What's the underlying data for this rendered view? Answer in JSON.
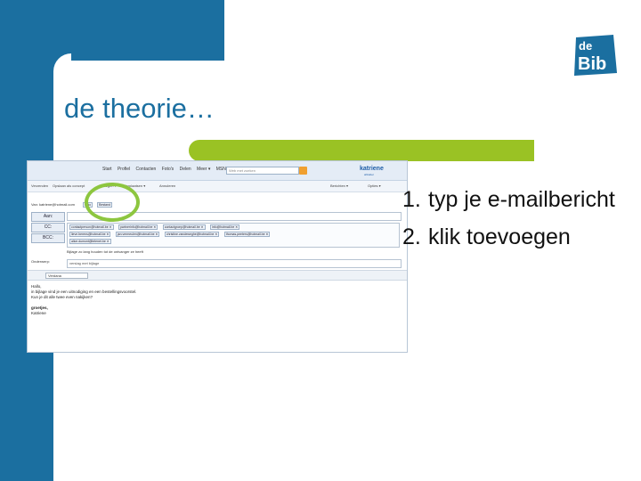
{
  "slide": {
    "title": "de theorie…",
    "logo": {
      "line1": "de",
      "line2": "Bib"
    },
    "colors": {
      "brand_blue": "#1b6fa0",
      "accent_green": "#9ac224"
    },
    "steps": [
      {
        "number": "1.",
        "text": "typ je e-mailbericht"
      },
      {
        "number": "2.",
        "text": "klik toevoegen"
      }
    ]
  },
  "screenshot": {
    "nav": [
      "Start",
      "Profiel",
      "Contacten",
      "Foto's",
      "Delen",
      "Meer ▾",
      "MSN"
    ],
    "search_placeholder": "Web met zoeken",
    "brand": "katriene",
    "brand_sub": "ahbaber",
    "toolbar": {
      "left": [
        "Verzenden",
        "Opslaan als concept",
        "Invoegen ▾",
        "Verplaatsen ▾",
        "Annuleren"
      ],
      "right": [
        "Berichten ▾",
        "Opties ▾"
      ]
    },
    "from_label": "Van: katriene@hotmail.com",
    "attach_options": [
      "Foto",
      "Bestand"
    ],
    "buttons": {
      "to": "Aan:",
      "cc": "CC:",
      "bcc": "BCC:"
    },
    "recipients_row1": [
      "contactperson@hotmail.be ✕",
      "partnerinfo@hotmail.be ✕",
      "contactgroep@hotmail.be ✕",
      "info@hotmail.be ✕"
    ],
    "recipients_row2": [
      "lieve.berens@hotmail.be ✕",
      "jan.vermeulen@hotmail.be ✕",
      "christine.vandeweghe@hotmail.be ✕",
      "thomas.peeters@hotmail.be ✕"
    ],
    "recipients_row3": [
      "alice.dumont@telenet.be ✕"
    ],
    "hint": "Bijlage zo lang houden tot de ontvanger ze heeft",
    "subject_label": "Onderwerp:",
    "subject_value": "verslag met bijlage",
    "font_select": "Verdana",
    "body": [
      "Hallo,",
      "in bijlage vind je een uitnodiging en een bestellingsvoorstel.",
      "Kun je dit alle twee even nakijken?",
      "",
      "groetjes,",
      "Katriene"
    ]
  }
}
